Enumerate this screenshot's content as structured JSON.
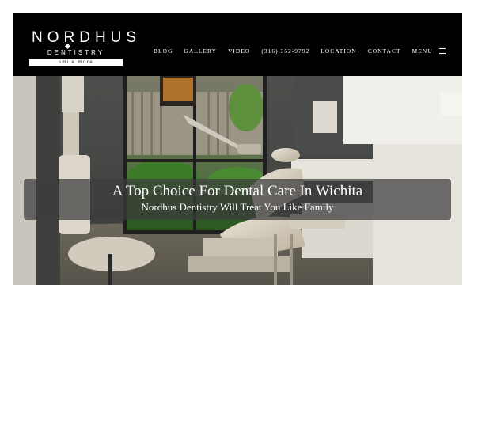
{
  "logo": {
    "name": "NORDHUS",
    "subtitle": "DENTISTRY",
    "tagline": "smile more"
  },
  "nav": {
    "items": [
      "BLOG",
      "GALLERY",
      "VIDEO",
      "(316) 352-9792",
      "LOCATION",
      "CONTACT"
    ],
    "menu_label": "MENU"
  },
  "hero": {
    "title": "A Top Choice For Dental Care In Wichita",
    "subtitle": "Nordhus Dentistry Will Treat You Like Family"
  },
  "colors": {
    "header_background": "#000000",
    "banner_overlay": "rgba(60,60,60,0.72)",
    "text": "#ffffff"
  }
}
